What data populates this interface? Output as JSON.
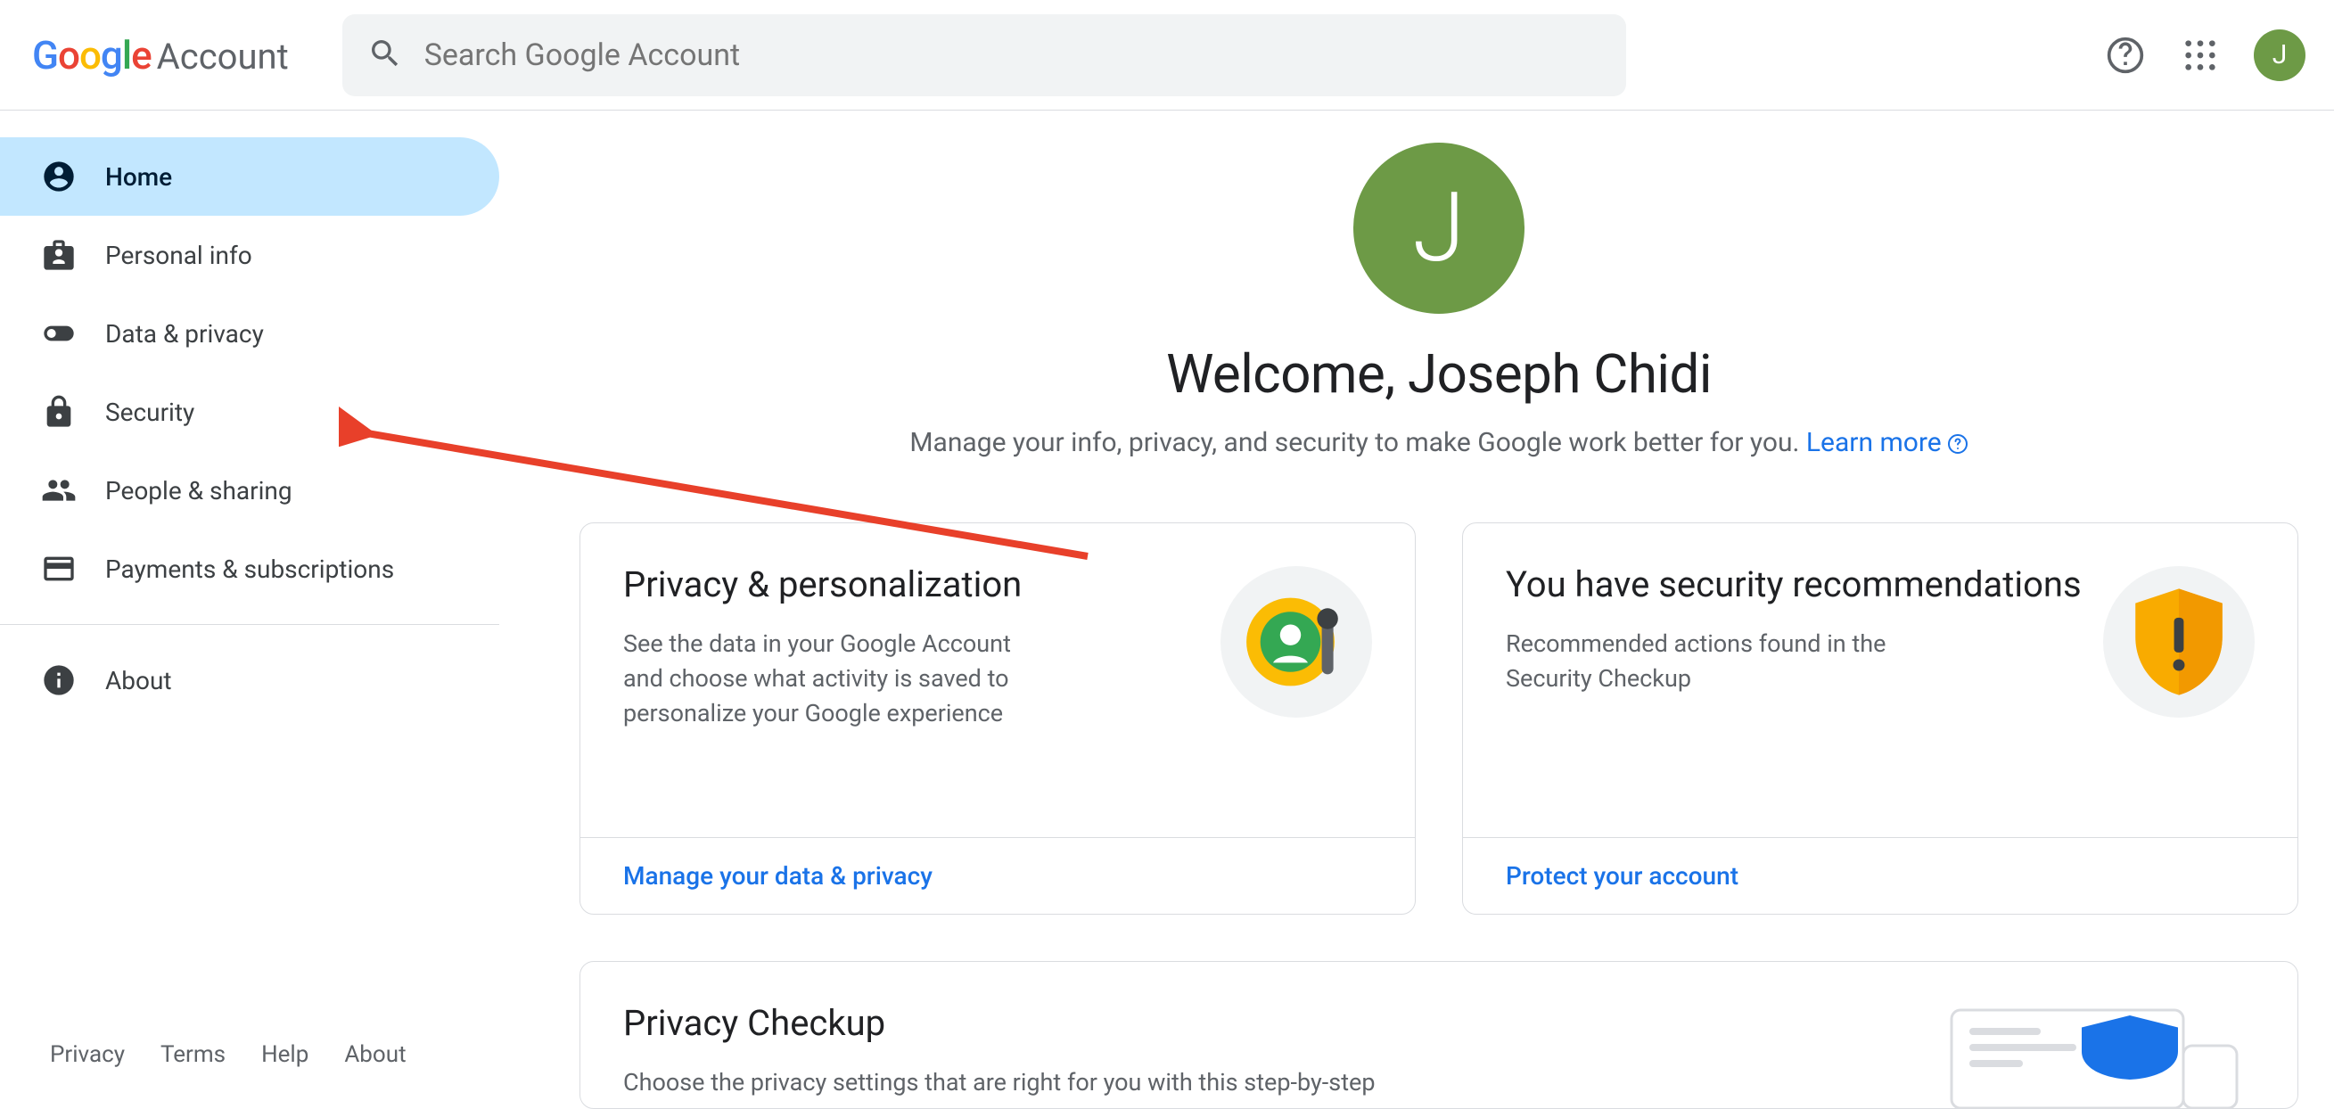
{
  "header": {
    "product": "Account",
    "search_placeholder": "Search Google Account",
    "avatar_initial": "J"
  },
  "sidebar": {
    "items": [
      {
        "label": "Home",
        "icon": "account-circle",
        "active": true
      },
      {
        "label": "Personal info",
        "icon": "badge",
        "active": false
      },
      {
        "label": "Data & privacy",
        "icon": "toggle",
        "active": false
      },
      {
        "label": "Security",
        "icon": "lock",
        "active": false
      },
      {
        "label": "People & sharing",
        "icon": "people",
        "active": false
      },
      {
        "label": "Payments & subscriptions",
        "icon": "card",
        "active": false
      }
    ],
    "about_label": "About",
    "footer": [
      "Privacy",
      "Terms",
      "Help",
      "About"
    ]
  },
  "main": {
    "avatar_initial": "J",
    "welcome": "Welcome, Joseph Chidi",
    "subhead_text": "Manage your info, privacy, and security to make Google work better for you. ",
    "learn_more": "Learn more",
    "cards": [
      {
        "title": "Privacy & personalization",
        "desc": "See the data in your Google Account and choose what activity is saved to personalize your Google experience",
        "cta": "Manage your data & privacy"
      },
      {
        "title": "You have security recommendations",
        "desc": "Recommended actions found in the Security Checkup",
        "cta": "Protect your account"
      }
    ],
    "wide_card": {
      "title": "Privacy Checkup",
      "desc": "Choose the privacy settings that are right for you with this step-by-step"
    }
  }
}
